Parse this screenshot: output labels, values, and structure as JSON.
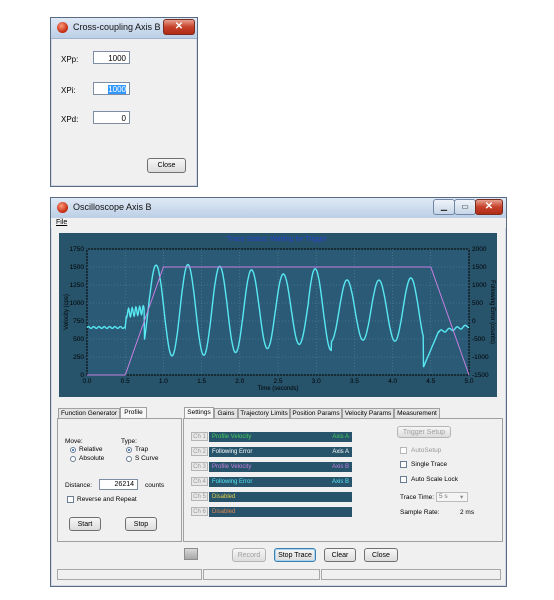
{
  "dialog": {
    "title": "Cross-coupling Axis B",
    "close_glyph": "✕",
    "fields": [
      {
        "label": "XPp:",
        "value": "1000"
      },
      {
        "label": "XPi:",
        "value": "1000"
      },
      {
        "label": "XPd:",
        "value": "0"
      }
    ],
    "close_button": "Close"
  },
  "scope": {
    "title": "Oscilloscope Axis B",
    "menu": [
      "File"
    ],
    "trace_status": "Trace Status:  Waiting for Trigger",
    "chart_data": {
      "type": "line",
      "xlabel": "Time (seconds)",
      "ylabel": "Velocity (cps)",
      "y2label": "Following Error (counts)",
      "xlim": [
        0.0,
        5.0
      ],
      "ylim": [
        0,
        1750
      ],
      "y2lim": [
        -1500,
        2000
      ],
      "x_ticks": [
        "0.0",
        "0.5",
        "1.0",
        "1.5",
        "2.0",
        "2.5",
        "3.0",
        "3.5",
        "4.0",
        "4.5",
        "5.0"
      ],
      "y_ticks": [
        "1750",
        "1500",
        "1250",
        "1000",
        "750",
        "500",
        "250",
        "0"
      ],
      "y2_ticks": [
        "2000",
        "1500",
        "1000",
        "500",
        "0",
        "-500",
        "-1000",
        "-1500"
      ],
      "grid": true,
      "series": [
        {
          "name": "Profile Velocity",
          "color": "#c77fe0",
          "points": [
            [
              0,
              0
            ],
            [
              0.5,
              0
            ],
            [
              1.0,
              1500
            ],
            [
              4.5,
              1500
            ],
            [
              5.0,
              0
            ]
          ]
        },
        {
          "name": "Following Error",
          "color": "#58e8f2"
        }
      ]
    },
    "left_panel": {
      "tabs": [
        "Function Generator",
        "Profile"
      ],
      "active_tab": "Profile",
      "move_label": "Move:",
      "move_options": [
        "Relative",
        "Absolute"
      ],
      "move_selected": "Relative",
      "type_label": "Type:",
      "type_options": [
        "Trap",
        "S Curve"
      ],
      "type_selected": "Trap",
      "distance_label": "Distance:",
      "distance_value": "26214",
      "distance_unit": "counts",
      "reverse_repeat": "Reverse and Repeat",
      "start": "Start",
      "stop": "Stop"
    },
    "right_panel": {
      "tabs": [
        "Settings",
        "Gains",
        "Trajectory Limits",
        "Position Params",
        "Velocity Params",
        "Measurement"
      ],
      "active_tab": "Settings",
      "channels": [
        {
          "ch": "Ch 1",
          "name": "Profile Velocity",
          "axis": "Axis A",
          "color": "#44d058"
        },
        {
          "ch": "Ch 2",
          "name": "Following Error",
          "axis": "Axis A",
          "color": "#ffffff"
        },
        {
          "ch": "Ch 3",
          "name": "Profile Velocity",
          "axis": "Axis B",
          "color": "#c77fe0"
        },
        {
          "ch": "Ch 4",
          "name": "Following Error",
          "axis": "Axis B",
          "color": "#58e8f2"
        },
        {
          "ch": "Ch 5",
          "name": "Disabled",
          "axis": "",
          "color": "#e3d34a"
        },
        {
          "ch": "Ch 6",
          "name": "Disabled",
          "axis": "",
          "color": "#e08a50"
        }
      ],
      "trigger_setup": "Trigger Setup",
      "autosetup": "AutoSetup",
      "single_trace": "Single Trace",
      "auto_scale_lock": "Auto Scale Lock",
      "trace_time_label": "Trace Time:",
      "trace_time_value": "5 s",
      "sample_rate_label": "Sample Rate:",
      "sample_rate_value": "2 ms"
    },
    "bottom_buttons": {
      "record": "Record",
      "stop_trace": "Stop Trace",
      "clear": "Clear",
      "close": "Close"
    }
  }
}
